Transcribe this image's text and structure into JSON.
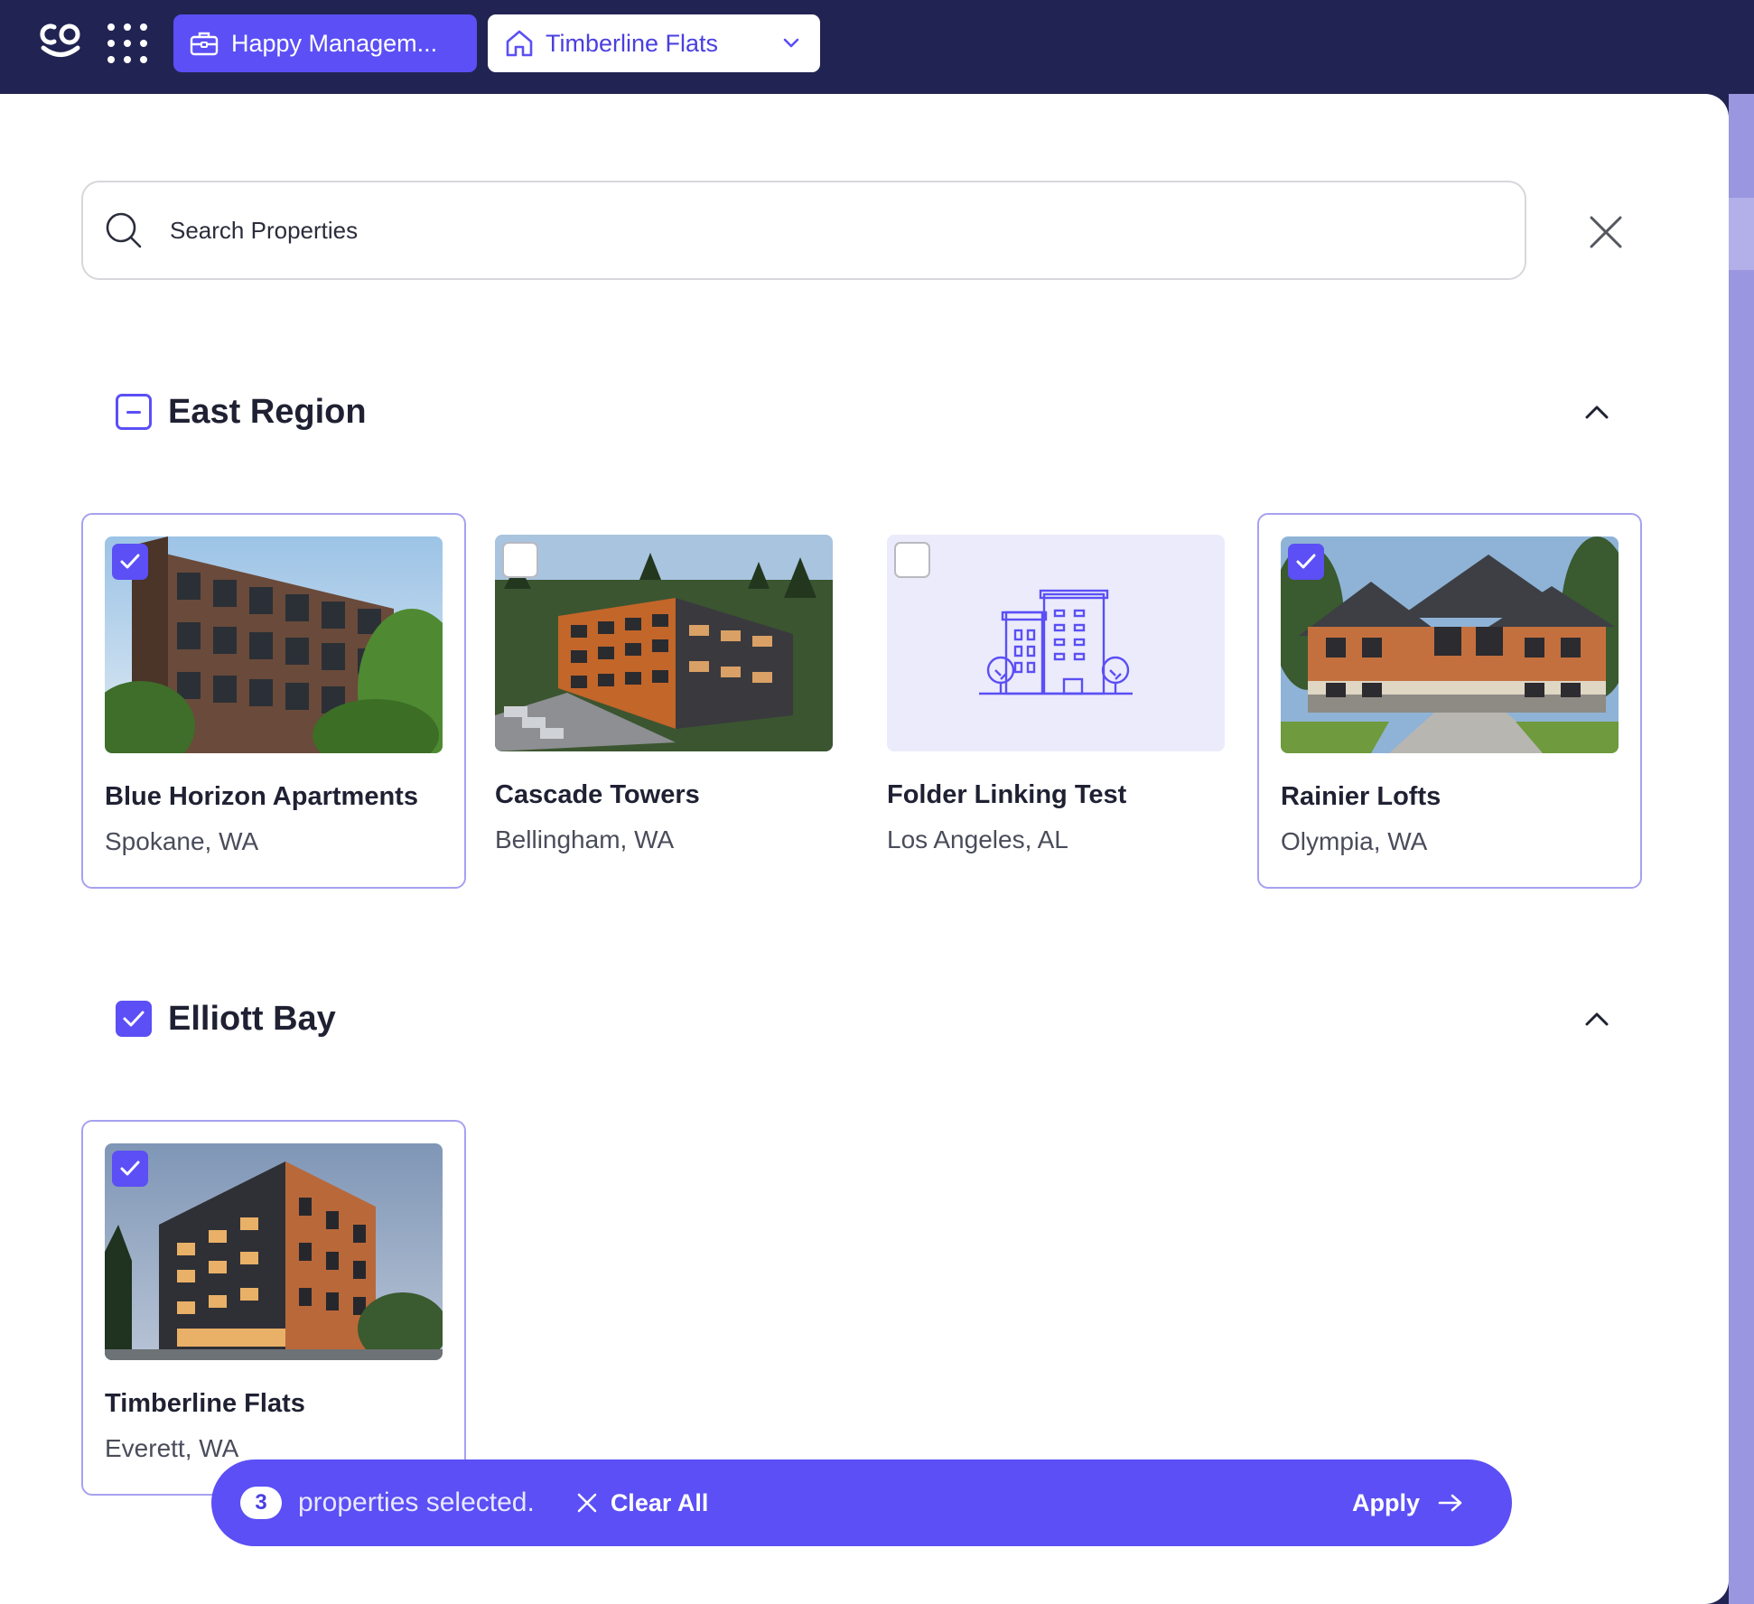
{
  "topbar": {
    "company_label": "Happy Managem...",
    "property_label": "Timberline Flats"
  },
  "search": {
    "placeholder": "Search Properties"
  },
  "groups": [
    {
      "title": "East Region",
      "state": "indeterminate",
      "properties": [
        {
          "name": "Blue Horizon Apartments",
          "location": "Spokane, WA",
          "selected": true,
          "image": "brick-apartment-photo"
        },
        {
          "name": "Cascade Towers",
          "location": "Bellingham, WA",
          "selected": false,
          "image": "aerial-apartment-photo"
        },
        {
          "name": "Folder Linking Test",
          "location": "Los Angeles, AL",
          "selected": false,
          "image": "building-placeholder-icon"
        },
        {
          "name": "Rainier Lofts",
          "location": "Olympia, WA",
          "selected": true,
          "image": "lodge-apartment-photo"
        }
      ]
    },
    {
      "title": "Elliott Bay",
      "state": "checked",
      "properties": [
        {
          "name": "Timberline Flats",
          "location": "Everett, WA",
          "selected": true,
          "image": "modern-tower-photo"
        }
      ]
    }
  ],
  "selection_bar": {
    "count": "3",
    "text": "properties selected.",
    "clear_label": "Clear All",
    "apply_label": "Apply"
  },
  "colors": {
    "accent": "#5b4ff5",
    "topbar": "#212452",
    "selected_border": "#a7a1f0"
  }
}
